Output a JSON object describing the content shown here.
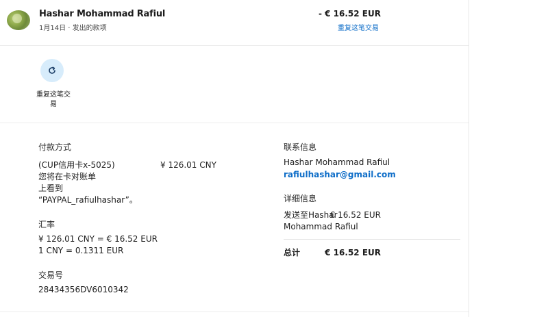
{
  "header": {
    "payee_name": "Hashar Mohammad Rafiul",
    "date": "1月14日",
    "separator": "·",
    "type": "发出的款项",
    "amount": "- € 16.52 EUR",
    "repeat_link": "重复这笔交易"
  },
  "action": {
    "repeat_label": "重复这笔交易"
  },
  "payment": {
    "heading": "付款方式",
    "method": "(CUP信用卡x-5025)",
    "cny_amount": "¥ 126.01 CNY",
    "statement_line1": "您将在卡对账单",
    "statement_line2": "上看到",
    "statement_line3": "“PAYPAL_rafiulhashar”。",
    "rate_heading": "汇率",
    "rate_conversion": "¥ 126.01 CNY = € 16.52 EUR",
    "rate_unit": "1 CNY = 0.1311 EUR",
    "txn_heading": "交易号",
    "txn_id": "28434356DV6010342"
  },
  "contact": {
    "heading": "联系信息",
    "name": "Hashar Mohammad Rafiul",
    "email": "rafiulhashar@gmail.com"
  },
  "details": {
    "heading": "详细信息",
    "sent_to_line1": "发送至Hashar",
    "sent_to_line2": "Mohammad Rafiul",
    "sent_amount": "€ 16.52 EUR",
    "total_label": "总计",
    "total_amount": "€ 16.52 EUR"
  },
  "colors": {
    "link": "#0f6ec8",
    "icon_bg": "#d7ecfb"
  },
  "icons": {
    "repeat": "refresh-icon"
  }
}
